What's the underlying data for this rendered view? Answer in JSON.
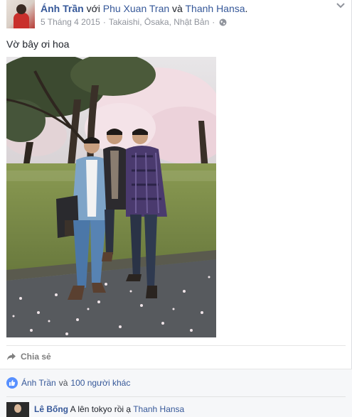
{
  "header": {
    "author": "Ánh Trần",
    "with_word": "với",
    "tagged_1": "Phu Xuan Tran",
    "and_word": "và",
    "tagged_2": "Thanh Hansa",
    "period": ".",
    "date": "5 Tháng 4 2015",
    "separator": "·",
    "location": "Takaishi, Ōsaka, Nhật Bản",
    "separator2": "·",
    "privacy_icon": "globe-icon",
    "menu_icon": "chevron-down-icon"
  },
  "post": {
    "caption": "Vờ bây ơi hoa"
  },
  "actions": {
    "share_label": "Chia sẻ",
    "share_icon": "share-arrow-icon"
  },
  "reactions": {
    "icon": "thumbs-up-icon",
    "name": "Ánh Trần",
    "and_word": "và",
    "others": "100 người khác"
  },
  "comment": {
    "author": "Lê Bống",
    "text": "A lên tokyo rồi ạ",
    "mention": "Thanh Hansa"
  },
  "colors": {
    "link": "#365899",
    "meta": "#90949c",
    "like_badge": "#5890ff",
    "footer_bg": "#f6f7f9"
  }
}
